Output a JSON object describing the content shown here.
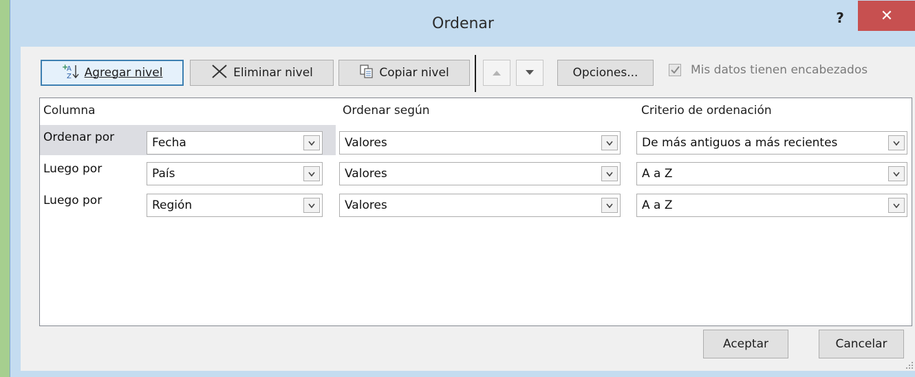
{
  "dialog": {
    "title": "Ordenar",
    "help_label": "?",
    "close_label": "✕"
  },
  "toolbar": {
    "add_level": "Agregar nivel",
    "delete_level": "Eliminar nivel",
    "copy_level": "Copiar nivel",
    "options": "Opciones...",
    "has_headers_label": "Mis datos tienen encabezados",
    "has_headers_checked": true
  },
  "grid": {
    "headers": {
      "column": "Columna",
      "sort_on": "Ordenar según",
      "order": "Criterio de ordenación"
    },
    "rows": [
      {
        "label": "Ordenar por",
        "column": "Fecha",
        "sort_on": "Valores",
        "order": "De más antiguos a más recientes",
        "selected": true
      },
      {
        "label": "Luego por",
        "column": "País",
        "sort_on": "Valores",
        "order": "A a Z",
        "selected": false
      },
      {
        "label": "Luego por",
        "column": "Región",
        "sort_on": "Valores",
        "order": "A a Z",
        "selected": false
      }
    ]
  },
  "footer": {
    "ok": "Aceptar",
    "cancel": "Cancelar"
  },
  "colors": {
    "desktop": "#a6cf8f",
    "titlebar": "#c4dcf0",
    "close": "#c75050",
    "client": "#f0f0f0",
    "focus_border": "#3c7fb1"
  }
}
